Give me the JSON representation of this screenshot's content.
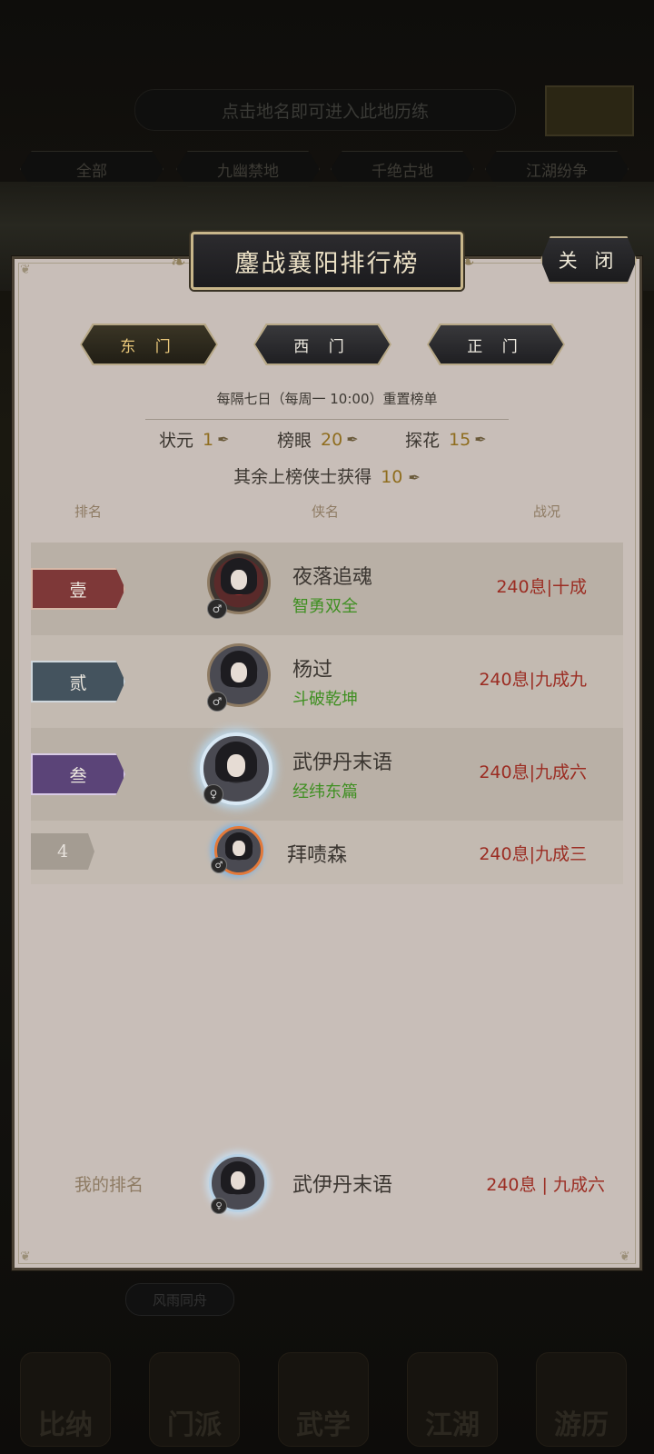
{
  "background": {
    "hint": "点击地名即可进入此地历练",
    "tabs": [
      "全部",
      "九幽禁地",
      "千绝古地",
      "江湖纷争"
    ],
    "small_button": "风雨同舟",
    "nav": [
      "比纳",
      "门派",
      "武学",
      "江湖",
      "游历"
    ]
  },
  "modal": {
    "title": "鏖战襄阳排行榜",
    "close_label": "关 闭",
    "gates": [
      {
        "label": "东 门",
        "active": true
      },
      {
        "label": "西 门",
        "active": false
      },
      {
        "label": "正 门",
        "active": false
      }
    ],
    "reset_note": "每隔七日（每周一 10:00）重置榜单",
    "rewards": {
      "first_label": "状元",
      "first_value": "1",
      "second_label": "榜眼",
      "second_value": "20",
      "third_label": "探花",
      "third_value": "15",
      "others_label": "其余上榜侠士获得",
      "others_value": "10"
    },
    "columns": {
      "rank": "排名",
      "name": "侠名",
      "status": "战况"
    },
    "rows": [
      {
        "rank": "壹",
        "name": "夜落追魂",
        "title": "智勇双全",
        "score": "240息|十成",
        "gender": "♂"
      },
      {
        "rank": "贰",
        "name": "杨过",
        "title": "斗破乾坤",
        "score": "240息|九成九",
        "gender": "♂"
      },
      {
        "rank": "叁",
        "name": "武伊丹末语",
        "title": "经纬东篇",
        "score": "240息|九成六",
        "gender": "♀"
      },
      {
        "rank": "4",
        "name": "拜啧森",
        "title": "",
        "score": "240息|九成三",
        "gender": "♂"
      }
    ],
    "my_rank": {
      "label": "我的排名",
      "name": "武伊丹末语",
      "score": "240息 | 九成六",
      "gender": "♀"
    }
  },
  "colors": {
    "panel": "#c8beb8",
    "score_red": "#9b2c22",
    "title_green": "#3f8f22",
    "gold_number": "#8f6d1e"
  }
}
